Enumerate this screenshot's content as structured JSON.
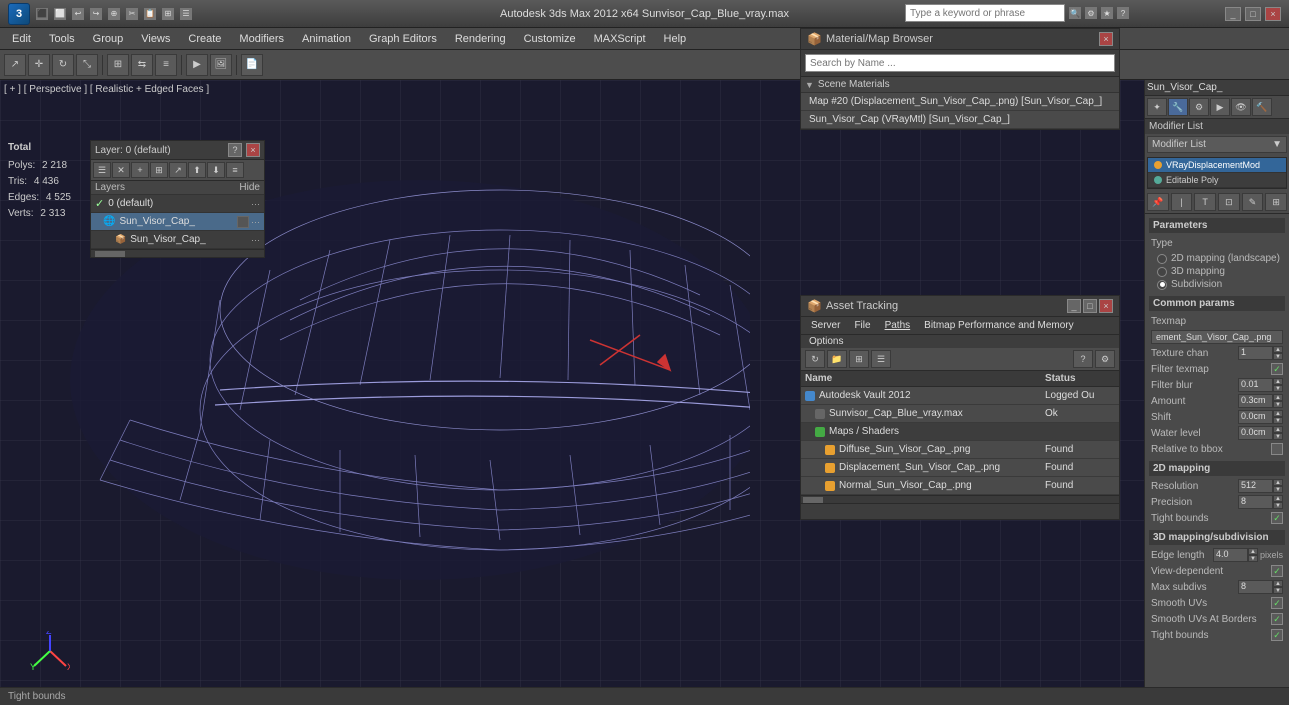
{
  "app": {
    "title": "Autodesk 3ds Max 2012 x64    Sunvisor_Cap_Blue_vray.max",
    "logo": "3",
    "search_placeholder": "Type a keyword or phrase"
  },
  "titlebar": {
    "buttons": [
      "_",
      "□",
      "×"
    ]
  },
  "menubar": {
    "items": [
      "Edit",
      "Tools",
      "Group",
      "Views",
      "Create",
      "Modifiers",
      "Animation",
      "Graph Editors",
      "Rendering",
      "Customize",
      "MAXScript",
      "Help"
    ]
  },
  "viewport": {
    "label": "[ + ] [ Perspective ] [ Realistic + Edged Faces ]"
  },
  "stats": {
    "total_label": "Total",
    "polys_label": "Polys:",
    "polys_value": "2 218",
    "tris_label": "Tris:",
    "tris_value": "4 436",
    "edges_label": "Edges:",
    "edges_value": "4 525",
    "verts_label": "Verts:",
    "verts_value": "2 313"
  },
  "layers": {
    "title": "Layer: 0 (default)",
    "help_btn": "?",
    "close_btn": "×",
    "col_layers": "Layers",
    "col_hide": "Hide",
    "items": [
      {
        "name": "0 (default)",
        "indent": 0,
        "active": false,
        "checked": true
      },
      {
        "name": "Sun_Visor_Cap_",
        "indent": 1,
        "active": true,
        "checked": false
      },
      {
        "name": "Sun_Visor_Cap_",
        "indent": 2,
        "active": false,
        "checked": false
      }
    ]
  },
  "material_browser": {
    "title": "Material/Map Browser",
    "search_placeholder": "Search by Name ...",
    "sections": [
      {
        "name": "Scene Materials",
        "items": [
          "Map #20 (Displacement_Sun_Visor_Cap_.png) [Sun_Visor_Cap_]",
          "Sun_Visor_Cap (VRayMtl) [Sun_Visor_Cap_]"
        ]
      }
    ]
  },
  "right_panel": {
    "object_name": "Sun_Visor_Cap_",
    "modifier_list_label": "Modifier List",
    "modifiers": [
      {
        "name": "VRayDisplacementMod",
        "active": true,
        "icon": "orange"
      },
      {
        "name": "Editable Poly",
        "active": false,
        "icon": "gray"
      }
    ]
  },
  "parameters": {
    "title": "Parameters",
    "type_label": "Type",
    "type_options": [
      {
        "label": "2D mapping (landscape)",
        "checked": false
      },
      {
        "label": "3D mapping",
        "checked": false
      },
      {
        "label": "Subdivision",
        "checked": true
      }
    ],
    "common_params_label": "Common params",
    "texmap_label": "Texmap",
    "texmap_value": "ement_Sun_Visor_Cap_.png",
    "texture_chan_label": "Texture chan",
    "texture_chan_value": "1",
    "filter_texmap_label": "Filter texmap",
    "filter_texmap_checked": true,
    "filter_blur_label": "Filter blur",
    "filter_blur_value": "0.01",
    "amount_label": "Amount",
    "amount_value": "0.3cm",
    "shift_label": "Shift",
    "shift_value": "0.0cm",
    "water_level_label": "Water level",
    "water_level_value": "0.0cm",
    "relative_to_bbox_label": "Relative to bbox",
    "relative_to_bbox_checked": false,
    "section_2d_label": "2D mapping",
    "resolution_label": "Resolution",
    "resolution_value": "512",
    "precision_label": "Precision",
    "precision_value": "8",
    "tight_bounds_label": "Tight bounds",
    "tight_bounds_checked": true,
    "section_3d_label": "3D mapping/subdivision",
    "edge_length_label": "Edge length",
    "edge_length_value": "4.0",
    "edge_length_unit": "pixels",
    "view_dependent_label": "View-dependent",
    "view_dependent_checked": true,
    "max_subdivs_label": "Max subdivs",
    "max_subdivs_value": "8",
    "smooth_uvs_label": "Smooth UVs",
    "smooth_uvs_checked": true,
    "smooth_uvs_borders_label": "Smooth UVs At Borders",
    "smooth_uvs_borders_checked": true,
    "tight_bounds_bottom_label": "Tight bounds",
    "tight_bounds_bottom_checked": true
  },
  "asset_tracking": {
    "title": "Asset Tracking",
    "menu_items": [
      "Server",
      "File",
      "Paths",
      "Bitmap Performance and Memory",
      "Options"
    ],
    "col_name": "Name",
    "col_status": "Status",
    "rows": [
      {
        "name": "Autodesk Vault 2012",
        "status": "Logged Ou",
        "icon": "blue",
        "indent": 0
      },
      {
        "name": "Sunvisor_Cap_Blue_vray.max",
        "status": "Ok",
        "icon": "gray",
        "indent": 1
      },
      {
        "name": "Maps / Shaders",
        "status": "",
        "icon": "green",
        "indent": 1
      },
      {
        "name": "Diffuse_Sun_Visor_Cap_.png",
        "status": "Found",
        "icon": "orange",
        "indent": 2
      },
      {
        "name": "Displacement_Sun_Visor_Cap_.png",
        "status": "Found",
        "icon": "orange",
        "indent": 2
      },
      {
        "name": "Normal_Sun_Visor_Cap_.png",
        "status": "Found",
        "icon": "orange",
        "indent": 2
      }
    ]
  },
  "statusbar": {
    "tight_bounds_label": "Tight bounds"
  }
}
